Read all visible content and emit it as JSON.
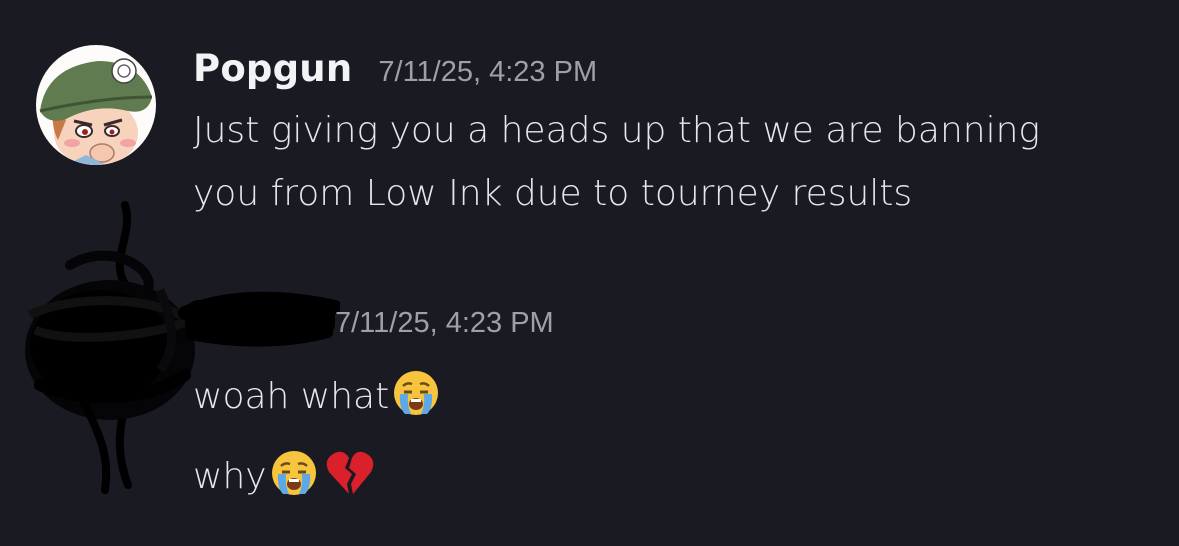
{
  "messages": [
    {
      "author": "Popgun",
      "timestamp": "7/11/25, 4:23 PM",
      "lines": [
        "Just giving you a heads up that we are banning",
        "you from Low Ink due to tourney results"
      ],
      "avatar_icon": "beret-character-avatar-icon"
    },
    {
      "author": "",
      "timestamp": "7/11/25, 4:23 PM",
      "avatar_icon": "redacted-scribble-avatar-icon",
      "lines": [
        {
          "text": "woah what",
          "emoji": [
            "loudly-crying-face-icon"
          ]
        },
        {
          "text": "why",
          "emoji": [
            "loudly-crying-face-icon",
            "broken-heart-icon"
          ]
        }
      ]
    }
  ],
  "colors": {
    "background": "#1a1a22",
    "username": "#f2f3f5",
    "timestamp": "#9ea0a8",
    "message_text": "#e6e7ea"
  }
}
